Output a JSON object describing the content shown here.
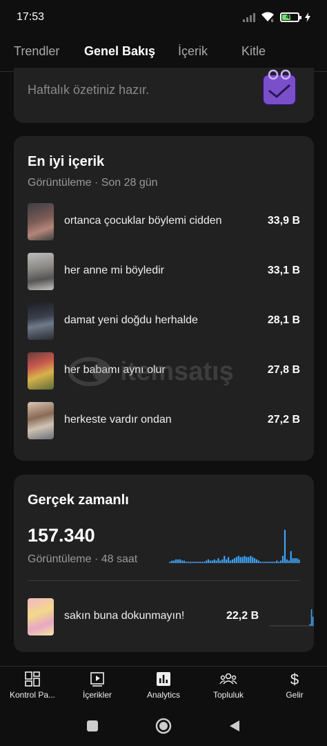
{
  "status_bar": {
    "time": "17:53",
    "battery": "49"
  },
  "tabs": [
    {
      "label": "Trendler"
    },
    {
      "label": "Genel Bakış",
      "active": true
    },
    {
      "label": "İçerik"
    },
    {
      "label": "Kitle"
    }
  ],
  "weekly": {
    "text": "Haftalık özetiniz hazır.",
    "icon": "calendar-check-icon"
  },
  "top_content": {
    "title": "En iyi içerik",
    "subtitle": "Görüntüleme · Son 28 gün",
    "items": [
      {
        "title": "ortanca çocuklar böylemi cidden",
        "value": "33,9 B"
      },
      {
        "title": "her anne mi böyledir",
        "value": "33,1 B"
      },
      {
        "title": "damat yeni doğdu herhalde",
        "value": "28,1 B"
      },
      {
        "title": "her babamı aynı olur",
        "value": "27,8 B"
      },
      {
        "title": "herkeste vardır ondan",
        "value": "27,2 B"
      }
    ]
  },
  "realtime": {
    "title": "Gerçek zamanlı",
    "total": "157.340",
    "subtitle": "Görüntüleme · 48 saat",
    "item": {
      "title": "sakın buna dokunmayın!",
      "value": "22,2 B"
    }
  },
  "chart_data": {
    "type": "bar",
    "series": [
      {
        "values": [
          1,
          2,
          2,
          3,
          3,
          3,
          2,
          2,
          1,
          1,
          1,
          1,
          1,
          1,
          1,
          1,
          1,
          1,
          2,
          3,
          2,
          2,
          3,
          2,
          4,
          2,
          3,
          6,
          3,
          5,
          2,
          3,
          4,
          5,
          6,
          5,
          5,
          6,
          5,
          5,
          6,
          5,
          4,
          3,
          2,
          1,
          1,
          1,
          1,
          1,
          1,
          1,
          1,
          2,
          1,
          2,
          6,
          28,
          3,
          2,
          10,
          4,
          4,
          4,
          3
        ]
      }
    ],
    "colors": [
      "#3ea6ff"
    ]
  },
  "mini_chart_data": {
    "type": "bar",
    "values": [
      0,
      0,
      0,
      0,
      0,
      0,
      0,
      0,
      0,
      0,
      0,
      0,
      0,
      0,
      0,
      0,
      0,
      0,
      0,
      0,
      0,
      0,
      0,
      0,
      0,
      0,
      0,
      0,
      1,
      9,
      5
    ]
  },
  "bottom_nav": [
    {
      "label": "Kontrol Pa...",
      "icon": "dashboard-icon"
    },
    {
      "label": "İçerikler",
      "icon": "content-icon"
    },
    {
      "label": "Analytics",
      "icon": "analytics-icon"
    },
    {
      "label": "Topluluk",
      "icon": "community-icon"
    },
    {
      "label": "Gelir",
      "icon": "dollar-icon"
    }
  ],
  "watermark": {
    "text": "itemsatış"
  }
}
